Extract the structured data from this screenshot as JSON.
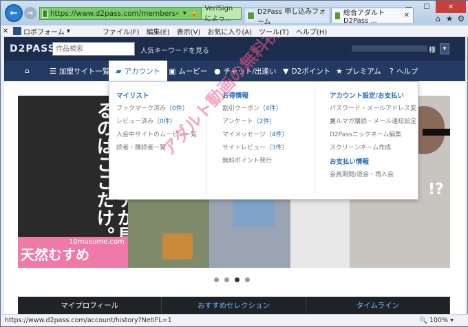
{
  "browser": {
    "url": "https://www.d2pass.com/members",
    "cert": "VeriSign によっ...",
    "tabs": [
      {
        "label": "D2Pass 申し込みフォーム"
      },
      {
        "label": "総合アダルト　D2Pass ..."
      }
    ],
    "toolbar_addon": "ロボフォーム",
    "menu": [
      "ファイル(F)",
      "編集(E)",
      "表示(V)",
      "お気に入り(A)",
      "ツール(T)",
      "ヘルプ(H)"
    ],
    "status_url": "https://www.d2pass.com/account/history?NetiFL=1",
    "zoom": "100%"
  },
  "site": {
    "logo": "D2PASS",
    "search_placeholder": "作品検索",
    "popular_keywords": "人気キーワードを見る",
    "honorific": "様",
    "nav": [
      {
        "label": "加盟サイト一覧",
        "icon": "list-icon"
      },
      {
        "label": "アカウント",
        "icon": "folder-icon"
      },
      {
        "label": "ムービー",
        "icon": "film-icon"
      },
      {
        "label": "チャット/出逢い",
        "icon": "chat-icon"
      },
      {
        "label": "D2ポイント",
        "icon": "trophy-icon"
      },
      {
        "label": "プレミアム",
        "icon": "star-icon"
      },
      {
        "label": "ヘルプ",
        "icon": "question-icon"
      }
    ],
    "dropdown": {
      "col1": {
        "heading": "マイリスト",
        "items": [
          {
            "label": "ブックマーク済み",
            "count": "（0件）"
          },
          {
            "label": "レビュー済み",
            "count": "（0件）"
          },
          {
            "label": "入会中サイトのムービー一覧",
            "count": ""
          },
          {
            "label": "読者・購読者一覧",
            "count": ""
          }
        ]
      },
      "col2": {
        "heading": "お得情報",
        "items": [
          {
            "label": "割引クーポン",
            "count": "（4件）"
          },
          {
            "label": "アンケート",
            "count": "（2件）"
          },
          {
            "label": "マイメッセージ",
            "count": "（4件）"
          },
          {
            "label": "サイトレビュー",
            "count": "（3件）"
          },
          {
            "label": "無料ポイント発行",
            "count": ""
          }
        ]
      },
      "col3": {
        "heading": "アカウント設定/お支払い",
        "items": [
          "パスワード・メールアドレス変更",
          "メルマガ購読・メール通知設定",
          "D2Passニックネーム編集",
          "スクリーンネーム作成"
        ],
        "heading2": "お支払い情報",
        "items2": [
          "会員期間/退会・再入会"
        ]
      }
    },
    "hero": {
      "banner_text": "こんな普通に可愛い素人のエッチが見れるのはここだけ。",
      "brand": "天然むすめ",
      "brand_url": "10musume.com",
      "badge": "!?"
    },
    "bottom_tabs": [
      "マイプロフィール",
      "おすすめセレクション",
      "タイムライン"
    ],
    "watermark": "アダルト動画の無料視聴レビュー"
  }
}
